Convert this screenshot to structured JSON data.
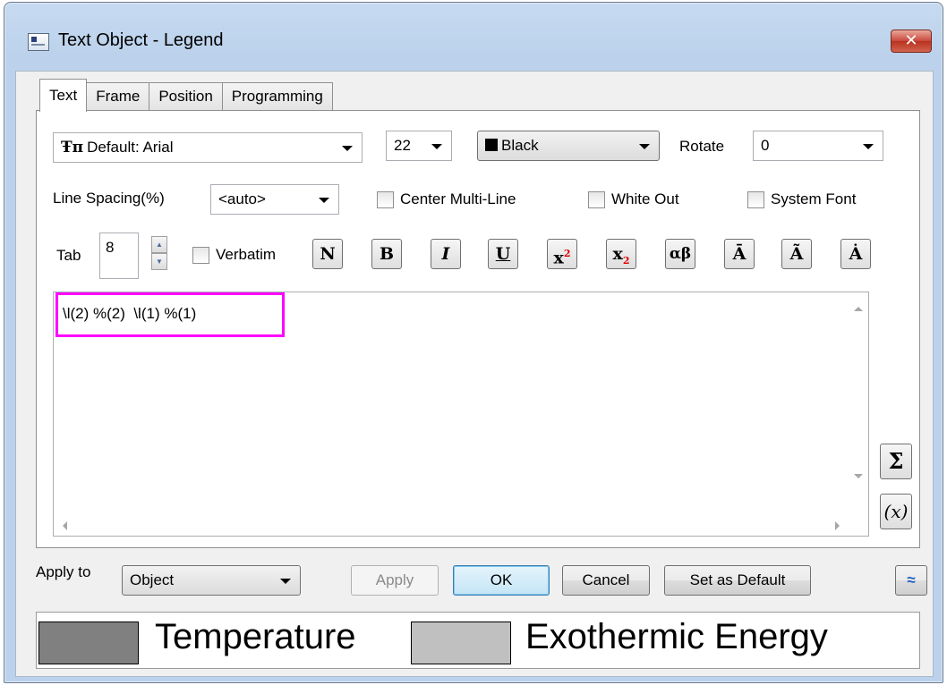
{
  "window": {
    "title": "Text Object - Legend",
    "close_label": "✕"
  },
  "tabs": [
    {
      "label": "Text",
      "active": true
    },
    {
      "label": "Frame",
      "active": false
    },
    {
      "label": "Position",
      "active": false
    },
    {
      "label": "Programming",
      "active": false
    }
  ],
  "text_tab": {
    "font": {
      "glyph": "Ŧп",
      "value": "Default: Arial"
    },
    "size": "22",
    "color": {
      "value": "Black",
      "swatch": "#000000"
    },
    "rotate": {
      "label": "Rotate",
      "value": "0"
    },
    "line_spacing": {
      "label": "Line Spacing(%)",
      "value": "<auto>"
    },
    "checkboxes": {
      "center_multiline": {
        "label": "Center Multi-Line",
        "checked": false
      },
      "white_out": {
        "label": "White Out",
        "checked": false
      },
      "system_font": {
        "label": "System Font",
        "checked": false
      },
      "verbatim": {
        "label": "Verbatim",
        "checked": false
      }
    },
    "tab": {
      "label": "Tab",
      "value": "8"
    },
    "format_buttons": {
      "normal": "N",
      "bold": "B",
      "italic": "I",
      "underline": "U",
      "superscript_base": "x",
      "superscript_mark": "2",
      "subscript_base": "x",
      "subscript_mark": "2",
      "greek": "αβ",
      "overbar": "Ā",
      "tilde": "Ã",
      "dot": "Ȧ"
    },
    "editor_text": "\\l(2) %(2)  \\l(1) %(1)",
    "side_buttons": {
      "sum": "Σ",
      "variable": "(x)"
    }
  },
  "bottom": {
    "apply_to_label": "Apply to",
    "apply_to_value": "Object",
    "apply": "Apply",
    "ok": "OK",
    "cancel": "Cancel",
    "set_default": "Set as Default",
    "collapse_icon": "≈"
  },
  "preview": {
    "items": [
      {
        "label": "Temperature",
        "color": "#808080"
      },
      {
        "label": "Exothermic Energy",
        "color": "#c0c0c0"
      }
    ]
  },
  "colors": {
    "highlight": "#ff00ff",
    "title_bg": "#bcd2ec",
    "close_red": "#c8463a"
  }
}
